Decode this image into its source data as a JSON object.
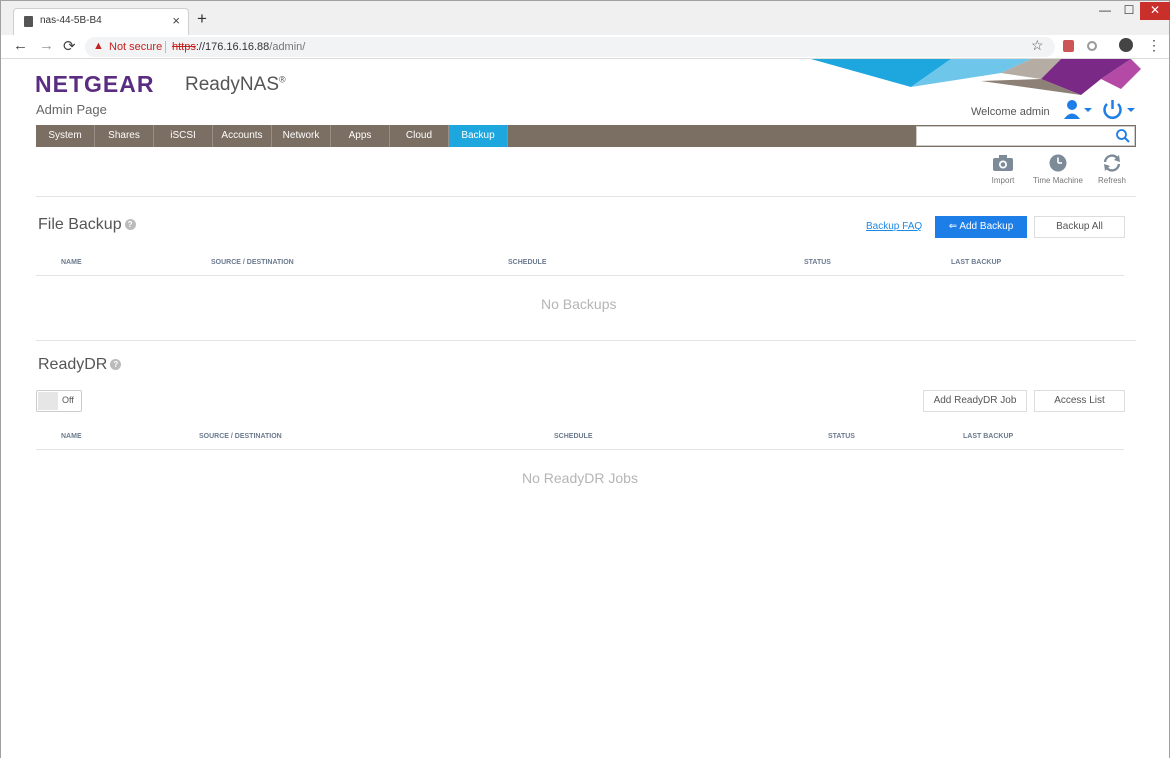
{
  "browser": {
    "tab_title": "nas-44-5B-B4",
    "tab_close": "×",
    "new_tab": "+",
    "win_min": "—",
    "win_max": "☐",
    "win_close": "✕",
    "security_label": "Not secure",
    "url_scheme": "https",
    "url_host": "://176.16.16.88",
    "url_path": "/admin/"
  },
  "header": {
    "logo": "NETGEAR",
    "product": "ReadyNAS",
    "product_mark": "®",
    "subtitle": "Admin Page",
    "welcome": "Welcome admin"
  },
  "nav": {
    "items": [
      {
        "label": "System"
      },
      {
        "label": "Shares"
      },
      {
        "label": "iSCSI"
      },
      {
        "label": "Accounts"
      },
      {
        "label": "Network"
      },
      {
        "label": "Apps"
      },
      {
        "label": "Cloud"
      },
      {
        "label": "Backup"
      }
    ],
    "active": "Backup"
  },
  "tools": {
    "import": "Import",
    "time_machine": "Time Machine",
    "refresh": "Refresh"
  },
  "file_backup": {
    "title": "File Backup",
    "help": "?",
    "faq_link": "Backup FAQ",
    "add_button": "Add Backup",
    "backup_all_button": "Backup All",
    "columns": [
      "NAME",
      "SOURCE / DESTINATION",
      "SCHEDULE",
      "STATUS",
      "LAST BACKUP"
    ],
    "empty_text": "No Backups"
  },
  "readydr": {
    "title": "ReadyDR",
    "help": "?",
    "toggle_label": "Off",
    "add_job_button": "Add ReadyDR Job",
    "access_list_button": "Access List",
    "columns": [
      "NAME",
      "SOURCE / DESTINATION",
      "SCHEDULE",
      "STATUS",
      "LAST BACKUP"
    ],
    "empty_text": "No ReadyDR Jobs"
  },
  "colors": {
    "brand_purple": "#5a2d82",
    "nav_bg": "#7b6e62",
    "nav_active": "#1ea6df",
    "primary_button": "#1e7ee8"
  }
}
